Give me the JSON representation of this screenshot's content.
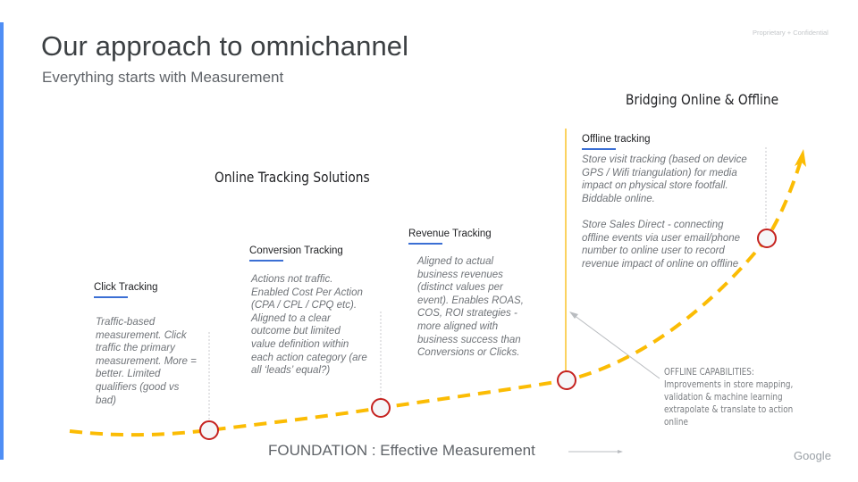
{
  "slide": {
    "title": "Our approach to omnichannel",
    "subtitle": "Everything starts with Measurement",
    "confidentiality": "Proprietary + Confidential",
    "brand": "Google",
    "accent_color": "#4f8ef5"
  },
  "sections": {
    "bridging": "Bridging Online & Offline",
    "online_solutions": "Online Tracking Solutions"
  },
  "stages": [
    {
      "title": "Click Tracking",
      "body": "Traffic-based measurement. Click traffic the primary measurement. More = better. Limited qualifiers (good vs bad)"
    },
    {
      "title": "Conversion Tracking",
      "body": "Actions not traffic. Enabled Cost Per Action (CPA / CPL / CPQ etc). Aligned to a clear outcome but limited value definition within each action category (are all ‘leads’ equal?)"
    },
    {
      "title": "Revenue Tracking",
      "body": "Aligned to actual business revenues (distinct values per event). Enables ROAS, COS, ROI strategies - more aligned with business success than Conversions or Clicks."
    },
    {
      "title": "Offline tracking",
      "body_1": "Store visit tracking (based on device GPS / Wifi triangulation) for media impact on physical store footfall. Biddable online.",
      "body_2": "Store Sales Direct - connecting offline events via user email/phone number to online user to record revenue impact of online on offline"
    }
  ],
  "offline_capabilities": {
    "heading": "OFFLINE CAPABILITIES:",
    "body": "Improvements in store mapping, validation & machine learning extrapolate & translate to action online"
  },
  "foundation": "FOUNDATION : Effective Measurement",
  "colors": {
    "curve": "#fbbc04",
    "milestone_ring": "#c5221f",
    "milestone_fill": "#f5f6f8",
    "divider": "#f9b90a",
    "underline": "#3b6fd4"
  }
}
